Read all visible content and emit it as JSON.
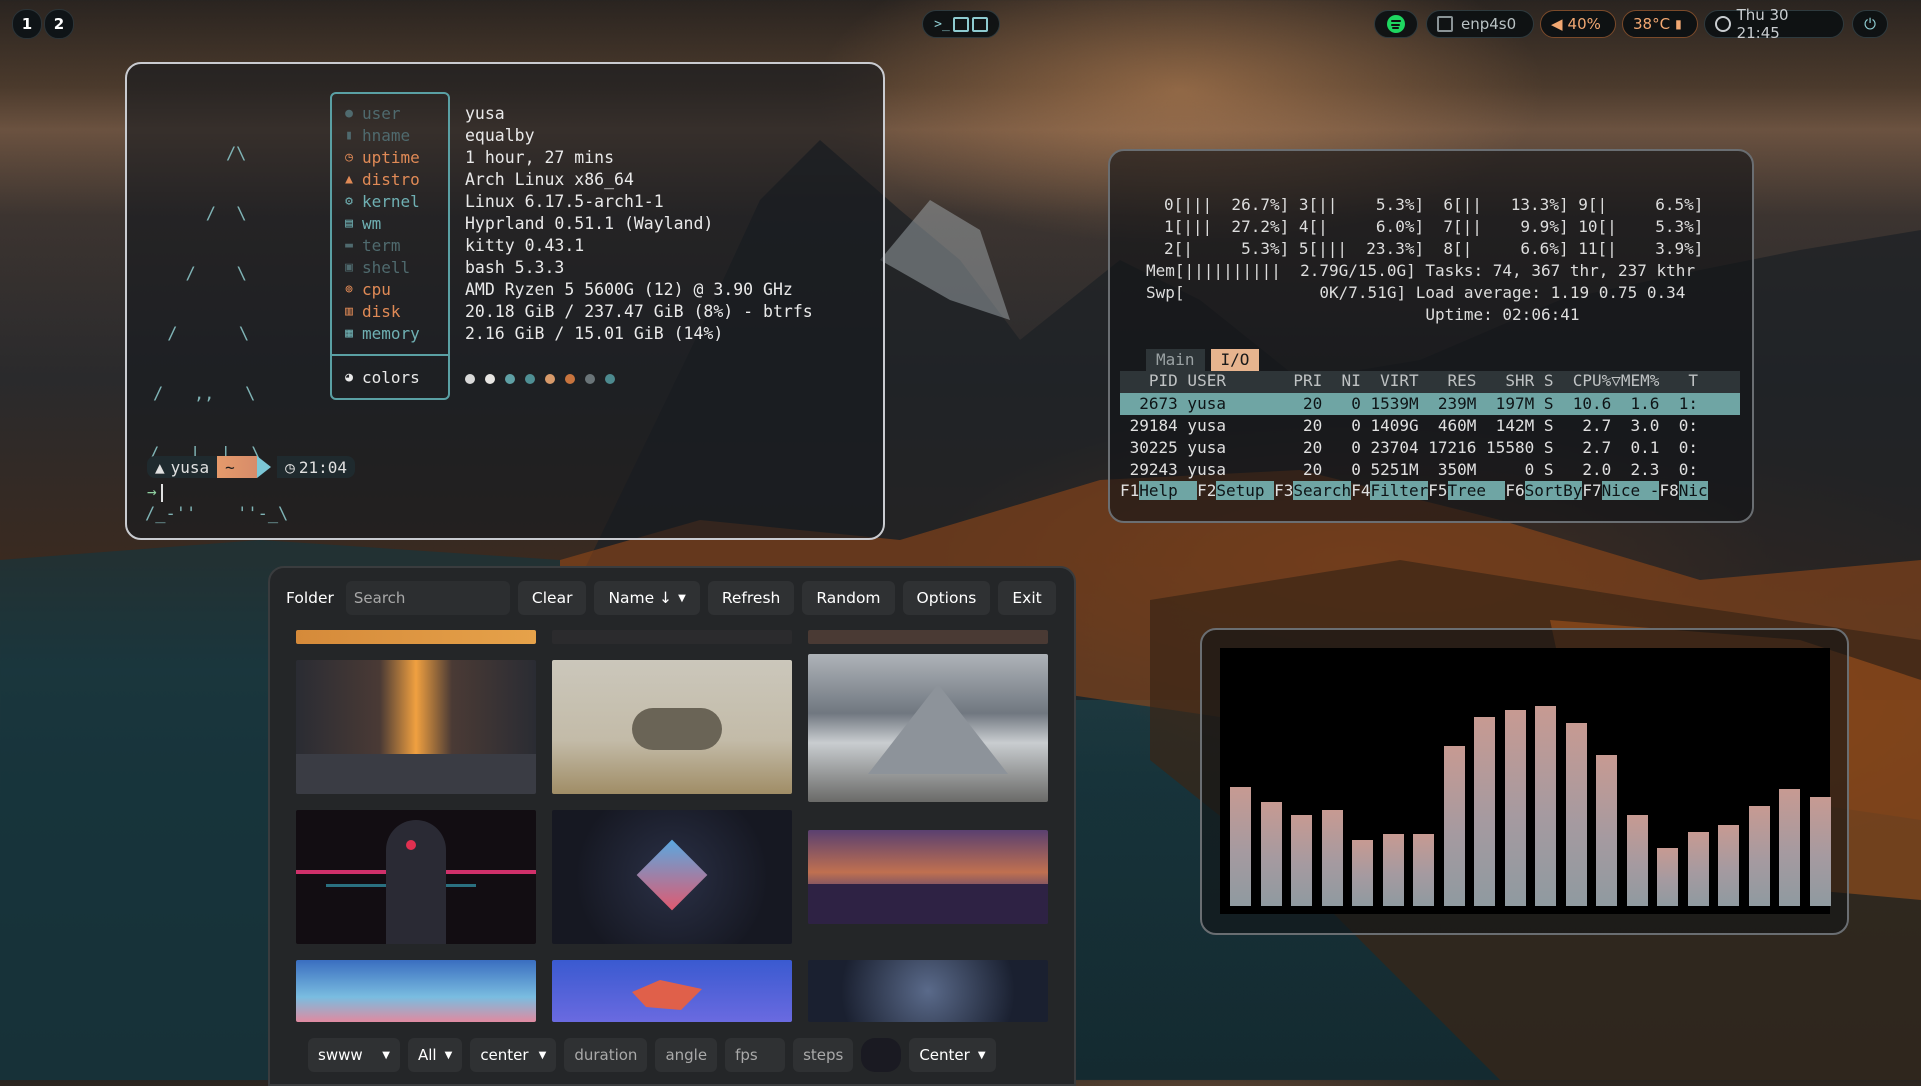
{
  "topbar": {
    "workspaces": [
      "1",
      "2"
    ],
    "terminal_icon": "terminal-icon",
    "network_label": "enp4s0",
    "volume_label": "40%",
    "temp_label": "38°C",
    "clock_label": "Thu 30 21:45"
  },
  "fastfetch": {
    "logo_lines": [
      "    /\\",
      "   /  \\",
      "  /    \\",
      " /      \\",
      "/   ,,   \\",
      "/   |  |  \\",
      "/_-''    ''-_\\"
    ],
    "labels": [
      "user",
      "hname",
      "uptime",
      "distro",
      "kernel",
      "wm",
      "term",
      "shell",
      "cpu",
      "disk",
      "memory"
    ],
    "values": [
      "yusa",
      "equalby",
      "1 hour, 27 mins",
      "Arch Linux x86_64",
      "Linux 6.17.5-arch1-1",
      "Hyprland 0.51.1 (Wayland)",
      "kitty 0.43.1",
      "bash 5.3.3",
      "AMD Ryzen 5 5600G (12) @ 3.90 GHz",
      "20.18 GiB / 237.47 GiB (8%) - btrfs",
      "2.16 GiB / 15.01 GiB (14%)"
    ],
    "colors_label": "colors",
    "palette": [
      "#d9d9d9",
      "#e8e6e3",
      "#5fa0a5",
      "#4f8f94",
      "#d89a6a",
      "#c8743e",
      "#6a7478",
      "#4d8a8f"
    ],
    "prompt_user": "yusa",
    "prompt_dir": "~",
    "prompt_time": "21:04",
    "prompt_arrow": "→"
  },
  "htop": {
    "cpu_rows": [
      "0[|||  26.7%] 3[||    5.3%]  6[||   13.3%] 9[|     6.5%]",
      "1[|||  27.2%] 4[|     6.0%]  7[||    9.9%] 10[|    5.3%]",
      "2[|     5.3%] 5[|||  23.3%]  8[|     6.6%] 11[|    3.9%]"
    ],
    "mem_row": "Mem[||||||||||  2.79G/15.0G] Tasks: 74, 367 thr, 237 kthr",
    "swp_row": "Swp[              0K/7.51G] Load average: 1.19 0.75 0.34",
    "uptime_row": "                             Uptime: 02:06:41",
    "tabs": [
      "Main",
      "I/O"
    ],
    "header": "   PID USER       PRI  NI  VIRT   RES   SHR S  CPU%▽MEM%   T",
    "processes": [
      "  2673 yusa        20   0 1539M  239M  197M S  10.6  1.6  1:",
      " 29184 yusa        20   0 1409G  460M  142M S   2.7  3.0  0:",
      " 30225 yusa        20   0 23704 17216 15580 S   2.7  0.1  0:",
      " 29243 yusa        20   0 5251M  350M     0 S   2.0  2.3  0:"
    ],
    "fkeys": [
      {
        "key": "F1",
        "label": "Help  "
      },
      {
        "key": "F2",
        "label": "Setup "
      },
      {
        "key": "F3",
        "label": "Search"
      },
      {
        "key": "F4",
        "label": "Filter"
      },
      {
        "key": "F5",
        "label": "Tree  "
      },
      {
        "key": "F6",
        "label": "SortBy"
      },
      {
        "key": "F7",
        "label": "Nice -"
      },
      {
        "key": "F8",
        "label": "Nic"
      }
    ]
  },
  "cava": {
    "levels": [
      0.63,
      0.55,
      0.48,
      0.51,
      0.35,
      0.38,
      0.38,
      0.85,
      1.0,
      1.04,
      1.06,
      0.97,
      0.8,
      0.48,
      0.31,
      0.39,
      0.43,
      0.53,
      0.62,
      0.58
    ]
  },
  "picker": {
    "folder": "Folder",
    "search_placeholder": "Search",
    "clear": "Clear",
    "sort": "Name ↓",
    "refresh": "Refresh",
    "random": "Random",
    "options": "Options",
    "exit": "Exit",
    "backend": "swww",
    "filter": "All",
    "position": "center",
    "duration_placeholder": "duration",
    "angle_placeholder": "angle",
    "fps_placeholder": "fps",
    "steps_placeholder": "steps",
    "align": "Center"
  }
}
